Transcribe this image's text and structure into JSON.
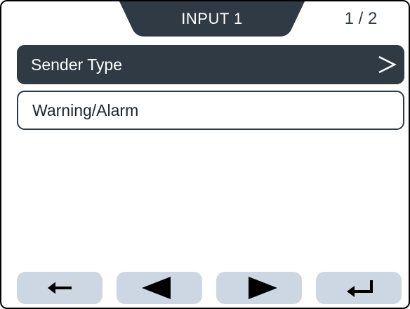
{
  "header": {
    "title": "INPUT 1",
    "page_indicator": "1 / 2"
  },
  "menu": {
    "items": [
      {
        "label": "Sender Type",
        "selected": true,
        "has_submenu": true,
        "arrow_glyph": ">"
      },
      {
        "label": "Warning/Alarm",
        "selected": false,
        "has_submenu": false
      }
    ]
  },
  "nav": {
    "buttons": [
      {
        "icon": "back-arrow-icon"
      },
      {
        "icon": "triangle-left-icon"
      },
      {
        "icon": "triangle-right-icon"
      },
      {
        "icon": "enter-return-icon"
      }
    ]
  },
  "colors": {
    "dark": "#2f3a45",
    "button_bg": "#cdd7e3",
    "background": "#ffffff",
    "text_dark": "#1e252c"
  }
}
